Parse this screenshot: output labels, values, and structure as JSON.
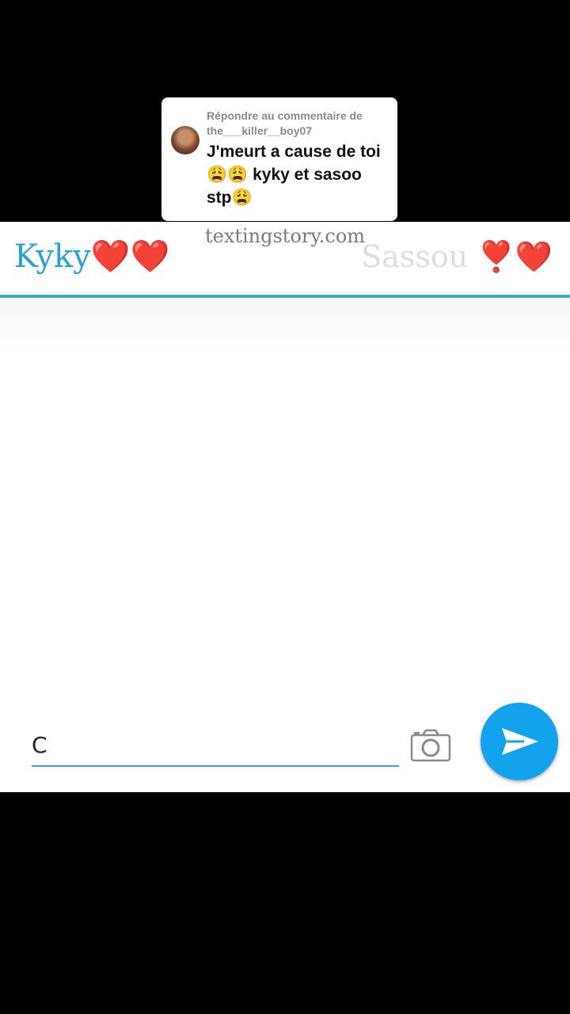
{
  "comment": {
    "reply_header": "Répondre au commentaire de the___killer__boy07",
    "text": "J'meurt a cause de toi😩😩 kyky et sasoo stp😩"
  },
  "watermark": "textingstory.com",
  "header": {
    "left_contact": "Kyky",
    "left_hearts": "❤️❤️",
    "right_contact": "Sassou ",
    "right_hearts": "❣️❤️"
  },
  "composer": {
    "input_value": "C",
    "camera_icon": "camera-icon",
    "send_icon": "send-icon",
    "accent_color": "#12a3ec"
  }
}
